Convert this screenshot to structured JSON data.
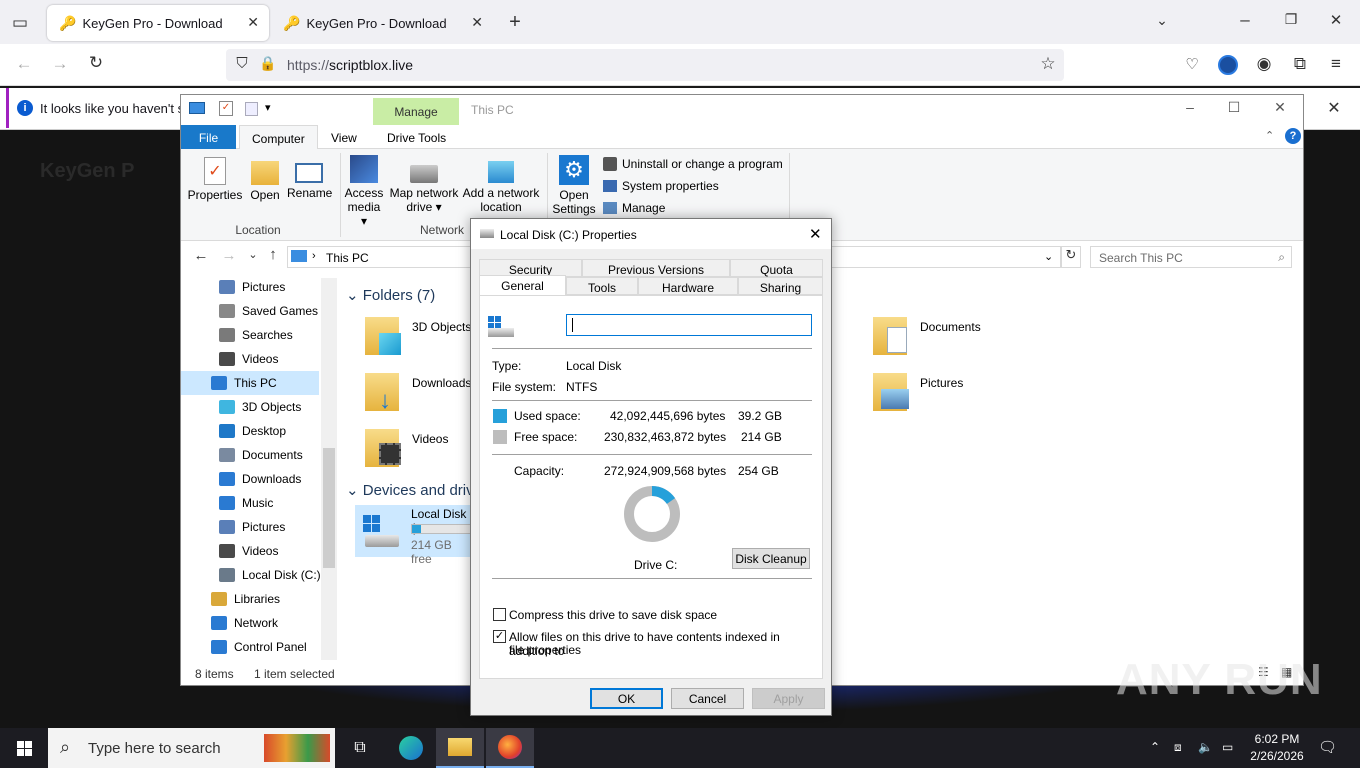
{
  "browser": {
    "tabs": [
      {
        "title": "KeyGen Pro - Download",
        "active": true
      },
      {
        "title": "KeyGen Pro - Download",
        "active": false
      }
    ],
    "url_proto": "https://",
    "url_host": "scriptblox.live",
    "notification": "It looks like you haven't sta"
  },
  "background": {
    "site_title": "KeyGen P"
  },
  "explorer": {
    "title": "This PC",
    "context_tab": "Manage",
    "tabs": [
      "File",
      "Computer",
      "View",
      "Drive Tools"
    ],
    "ribbon": {
      "properties": "Properties",
      "open": "Open",
      "rename": "Rename",
      "location_group": "Location",
      "access_media_1": "Access",
      "access_media_2": "media",
      "map_drive_1": "Map network",
      "map_drive_2": "drive",
      "add_location_1": "Add a network",
      "add_location_2": "location",
      "network_group": "Network",
      "open_settings_1": "Open",
      "open_settings_2": "Settings",
      "uninstall": "Uninstall or change a program",
      "system_properties": "System properties",
      "manage": "Manage"
    },
    "address": "This PC",
    "search_placeholder": "Search This PC",
    "nav": [
      {
        "label": "Pictures",
        "color": "#5a7fb8",
        "indent": 1
      },
      {
        "label": "Saved Games",
        "color": "#888",
        "indent": 1
      },
      {
        "label": "Searches",
        "color": "#7a7a7a",
        "indent": 1
      },
      {
        "label": "Videos",
        "color": "#4a4a4a",
        "indent": 1
      },
      {
        "label": "This PC",
        "color": "#2a7ad2",
        "indent": 0,
        "selected": true
      },
      {
        "label": "3D Objects",
        "color": "#3fb6e0",
        "indent": 1
      },
      {
        "label": "Desktop",
        "color": "#1e78c8",
        "indent": 1
      },
      {
        "label": "Documents",
        "color": "#7a8aa0",
        "indent": 1
      },
      {
        "label": "Downloads",
        "color": "#2a7ad2",
        "indent": 1
      },
      {
        "label": "Music",
        "color": "#2a7ad2",
        "indent": 1
      },
      {
        "label": "Pictures",
        "color": "#5a7fb8",
        "indent": 1
      },
      {
        "label": "Videos",
        "color": "#4a4a4a",
        "indent": 1
      },
      {
        "label": "Local Disk (C:)",
        "color": "#6a7a8a",
        "indent": 1
      },
      {
        "label": "Libraries",
        "color": "#d9a83a",
        "indent": 0
      },
      {
        "label": "Network",
        "color": "#2a7ad2",
        "indent": 0
      },
      {
        "label": "Control Panel",
        "color": "#2a7ad2",
        "indent": 0
      }
    ],
    "folders_header": "Folders (7)",
    "folders": [
      "3D Objects",
      "Downloads",
      "Videos",
      "Documents",
      "Pictures"
    ],
    "devices_header": "Devices and driv",
    "drive_name": "Local Disk (",
    "drive_free": "214 GB free",
    "status_items": "8 items",
    "status_selected": "1 item selected"
  },
  "dialog": {
    "title": "Local Disk (C:) Properties",
    "tabs_row1": [
      "Security",
      "Previous Versions",
      "Quota"
    ],
    "tabs_row2": [
      "General",
      "Tools",
      "Hardware",
      "Sharing"
    ],
    "name_value": "",
    "type_label": "Type:",
    "type_value": "Local Disk",
    "fs_label": "File system:",
    "fs_value": "NTFS",
    "used_label": "Used space:",
    "used_bytes": "42,092,445,696 bytes",
    "used_gb": "39.2 GB",
    "free_label": "Free space:",
    "free_bytes": "230,832,463,872 bytes",
    "free_gb": "214 GB",
    "cap_label": "Capacity:",
    "cap_bytes": "272,924,909,568 bytes",
    "cap_gb": "254 GB",
    "used_fraction": 0.154,
    "used_color": "#26a0da",
    "free_color": "#bdbdbd",
    "drive_label": "Drive C:",
    "cleanup": "Disk Cleanup",
    "compress": "Compress this drive to save disk space",
    "compress_checked": false,
    "index_1": "Allow files on this drive to have contents indexed in addition to",
    "index_2": "file properties",
    "index_checked": true,
    "ok": "OK",
    "cancel": "Cancel",
    "apply": "Apply"
  },
  "taskbar": {
    "search": "Type here to search",
    "time": "6:02 PM",
    "date": "2/26/2026"
  },
  "watermark": "ANY RUN"
}
